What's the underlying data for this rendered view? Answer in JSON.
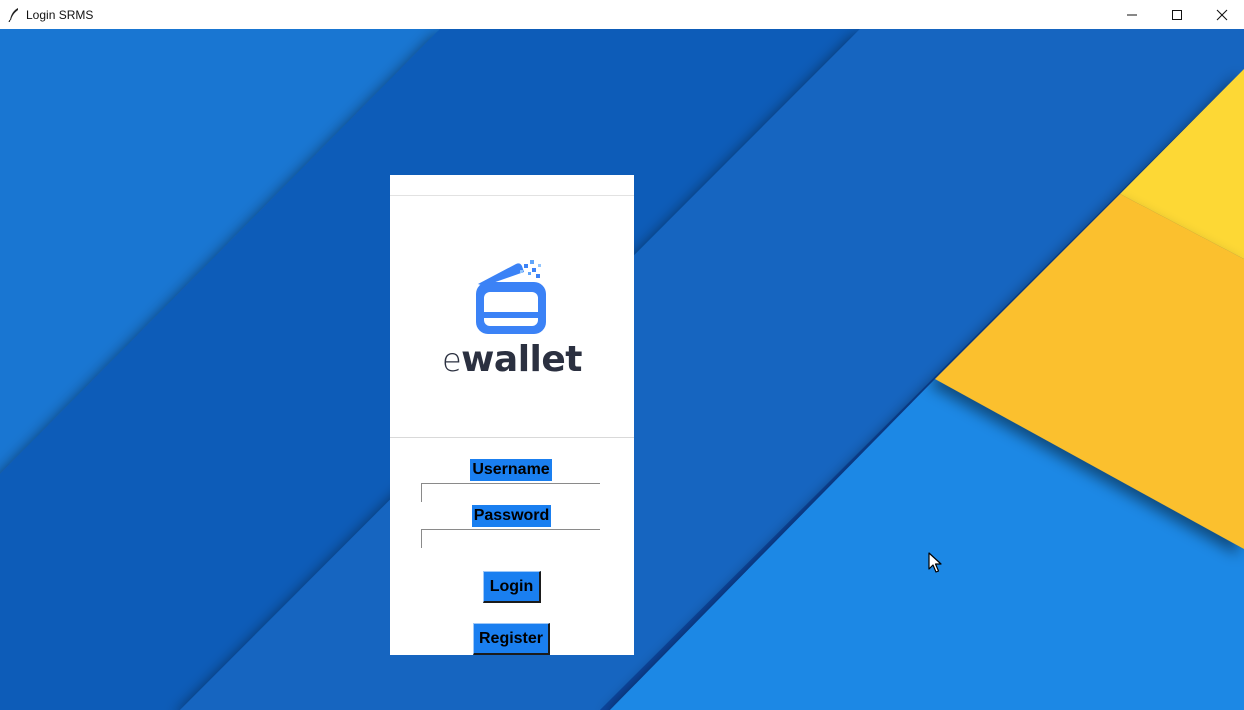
{
  "window": {
    "title": "Login SRMS",
    "controls": {
      "minimize_icon": "minimize-icon",
      "maximize_icon": "maximize-icon",
      "close_icon": "close-icon"
    }
  },
  "logo": {
    "prefix": "e",
    "word": "wallet",
    "icon": "wallet-card-icon",
    "color_icon": "#3b82f6",
    "color_text": "#2b3040"
  },
  "form": {
    "username_label": "Username",
    "username_value": "",
    "password_label": "Password",
    "password_value": "",
    "login_label": "Login",
    "register_label": "Register"
  },
  "colors": {
    "accent": "#1a7ff0",
    "bg_blue_dark": "#0d47a1",
    "bg_blue": "#1565c0",
    "bg_blue_light": "#1e88e5",
    "bg_yellow": "#fbc02d"
  }
}
